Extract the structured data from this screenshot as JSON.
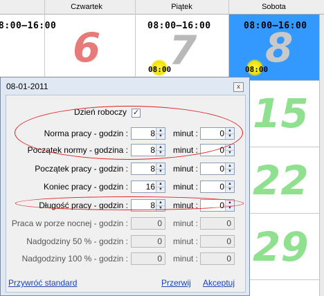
{
  "calendar": {
    "headers": [
      "Czwartek",
      "Piątek",
      "Sobota"
    ],
    "row1": {
      "left_time": "8:00–16:00",
      "left_num": "6",
      "friday_time": "08:00–16:00",
      "friday_num": "7",
      "friday_sun_time": "08:00",
      "saturday_time": "08:00–16:00",
      "saturday_num": "8",
      "saturday_sun_time": "08:00"
    },
    "saturday_nums": [
      "15",
      "22",
      "29"
    ],
    "colors": {
      "red": "#e87a7a",
      "green": "#8fe08f",
      "gray": "#b9b9b9",
      "blue": "#3399ff"
    }
  },
  "dialog": {
    "title": "08-01-2011",
    "close_glyph": "x",
    "workday_label": "Dzień roboczy",
    "workday_checked": true,
    "check_glyph": "✓",
    "minut_label": "minut :",
    "rows": [
      {
        "label": "Norma pracy - godzin :",
        "hours": "8",
        "minutes": "0"
      },
      {
        "label": "Początek normy - godzina :",
        "hours": "8",
        "minutes": "0"
      },
      {
        "label": "Początek pracy - godzin :",
        "hours": "8",
        "minutes": "0"
      },
      {
        "label": "Koniec pracy - godzin :",
        "hours": "16",
        "minutes": "0"
      },
      {
        "label": "Długość pracy - godzin :",
        "hours": "8",
        "minutes": "0"
      }
    ],
    "readonly_rows": [
      {
        "label": "Praca w porze nocnej - godzin :",
        "hours": "0",
        "minutes": "0"
      },
      {
        "label": "Nadgodziny 50 % - godzin :",
        "hours": "0",
        "minutes": "0"
      },
      {
        "label": "Nadgodziny 100 % - godzin :",
        "hours": "0",
        "minutes": "0"
      }
    ],
    "links": {
      "restore": "Przywróć standard",
      "cancel": "Przerwij",
      "accept": "Akceptuj"
    }
  }
}
